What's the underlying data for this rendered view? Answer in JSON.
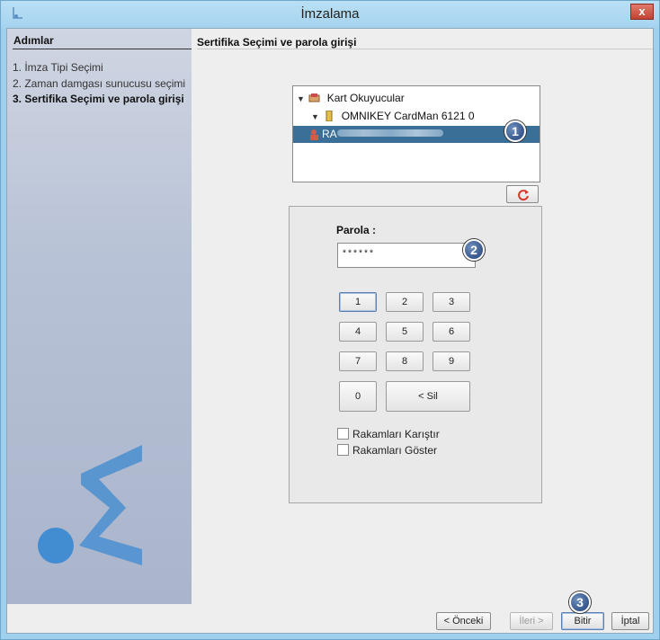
{
  "window": {
    "title": "İmzalama",
    "close_label": "x"
  },
  "steps": {
    "title": "Adımlar",
    "items": [
      "1. İmza Tipi Seçimi",
      "2. Zaman damgası sunucusu seçimi",
      "3. Sertifika Seçimi ve parola girişi"
    ],
    "active_index": 2
  },
  "section": {
    "title": "Sertifika Seçimi ve parola girişi"
  },
  "tree": {
    "root": "Kart Okuyucular",
    "reader": "OMNIKEY CardMan 6121 0",
    "cert_prefix": "RA"
  },
  "badges": [
    "1",
    "2",
    "3"
  ],
  "password": {
    "label": "Parola :",
    "value": "******"
  },
  "keypad": {
    "rows": [
      [
        "1",
        "2",
        "3"
      ],
      [
        "4",
        "5",
        "6"
      ],
      [
        "7",
        "8",
        "9"
      ]
    ],
    "zero": "0",
    "delete": "< Sil"
  },
  "options": {
    "shuffle": "Rakamları Karıştır",
    "show": "Rakamları Göster"
  },
  "buttons": {
    "prev": "< Önceki",
    "next": "İleri >",
    "finish": "Bitir",
    "cancel": "İptal"
  }
}
